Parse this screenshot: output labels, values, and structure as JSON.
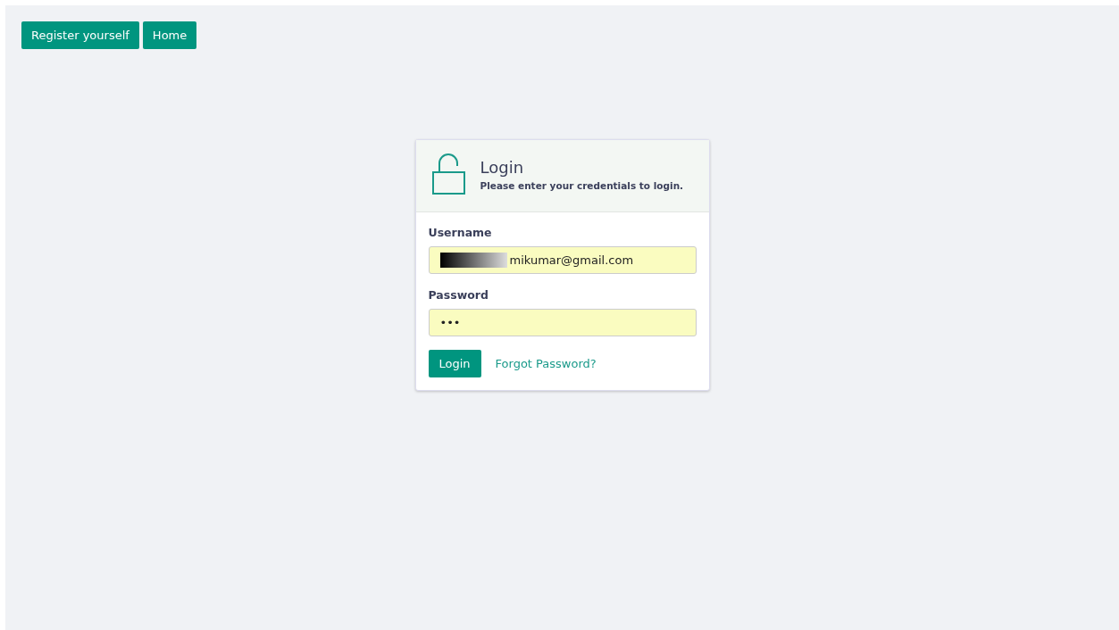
{
  "nav_buttons": [
    {
      "label": "Register yourself"
    },
    {
      "label": "Home"
    }
  ],
  "login_card": {
    "title": "Login",
    "subtitle": "Please enter your credentials to login.",
    "fields": [
      {
        "label": "Username",
        "value": "mikumar@gmail.com",
        "redacted": true
      },
      {
        "label": "Password",
        "value": "•••"
      }
    ],
    "submit": "Login",
    "forgot_link": "Forgot Password?"
  }
}
